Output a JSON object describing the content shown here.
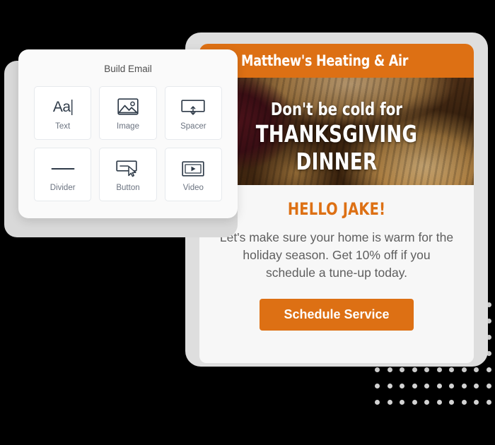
{
  "colors": {
    "brand_orange": "#DD7014",
    "card_gray": "#DEDEDE",
    "panel_bg": "#FAFAFA",
    "backdrop_gray": "#D9D9D9",
    "body_text": "#5E5E5E",
    "tile_label": "#6B7380",
    "dot": "#D2D2D2",
    "background": "#000000"
  },
  "builder_panel": {
    "title": "Build Email",
    "tiles": [
      {
        "label": "Text",
        "icon": "text-aa-icon",
        "glyph": "Aa"
      },
      {
        "label": "Image",
        "icon": "image-icon",
        "glyph": ""
      },
      {
        "label": "Spacer",
        "icon": "spacer-icon",
        "glyph": ""
      },
      {
        "label": "Divider",
        "icon": "divider-icon",
        "glyph": ""
      },
      {
        "label": "Button",
        "icon": "button-icon",
        "glyph": ""
      },
      {
        "label": "Video",
        "icon": "video-icon",
        "glyph": ""
      }
    ]
  },
  "email_preview": {
    "header": {
      "brand_name": "Matthew's Heating & Air",
      "logo_icon": "fan-swirl-logo-icon"
    },
    "hero": {
      "line1": "Don't be cold for",
      "line2": "THANKSGIVING DINNER",
      "image_description": "thanksgiving-table-photo"
    },
    "body": {
      "greeting": "HELLO JAKE!",
      "paragraph": "Let's make sure your home is warm for the holiday season. Get 10% off if you schedule a tune-up today.",
      "cta_label": "Schedule Service"
    }
  },
  "decoration": {
    "dot_grid_columns": 10,
    "dot_grid_rows": 7
  }
}
